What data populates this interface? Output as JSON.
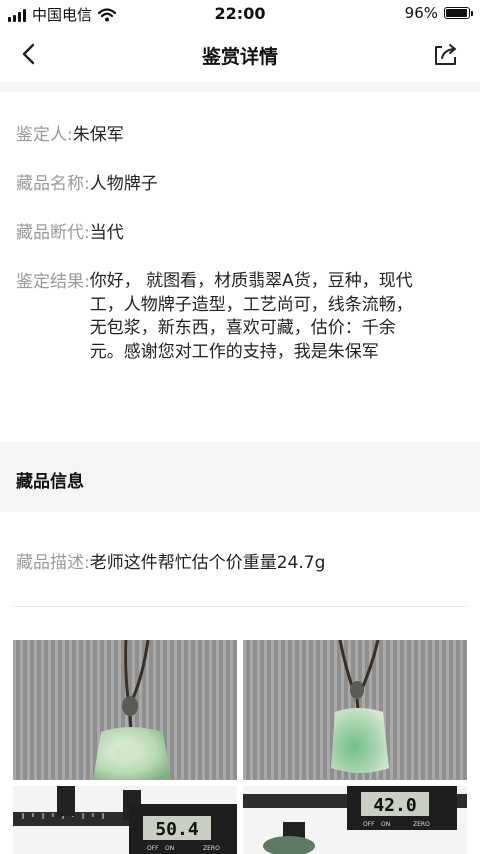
{
  "status": {
    "carrier": "中国电信",
    "time": "22:00",
    "battery": "96%",
    "battery_level": 0.96
  },
  "nav": {
    "title": "鉴赏详情",
    "back_icon": "back-chevron-icon",
    "share_icon": "share-icon"
  },
  "appraisal": {
    "appraiser_label": "鉴定人:",
    "appraiser": "朱保军",
    "name_label": "藏品名称:",
    "name": "人物牌子",
    "era_label": "藏品断代:",
    "era": "当代",
    "result_label": "鉴定结果:",
    "result": "你好， 就图看，材质翡翠A货，豆种，现代工，人物牌子造型，工艺尚可，线条流畅，无包浆，新东西，喜欢可藏，估价：千余元。感谢您对工作的支持，我是朱保军"
  },
  "item_info": {
    "section_title": "藏品信息",
    "desc_label": "藏品描述:",
    "desc": "老师这件帮忙估个价重量24.7g"
  },
  "photos": {
    "caliper_readings": [
      "50.4",
      "42.0"
    ],
    "caliper_badge": "ZERO",
    "caliper_on": "ON",
    "caliper_off": "OFF"
  },
  "colors": {
    "background": "#ffffff",
    "band": "#f5f5f5",
    "label": "#9a9a9a",
    "text": "#222222"
  }
}
